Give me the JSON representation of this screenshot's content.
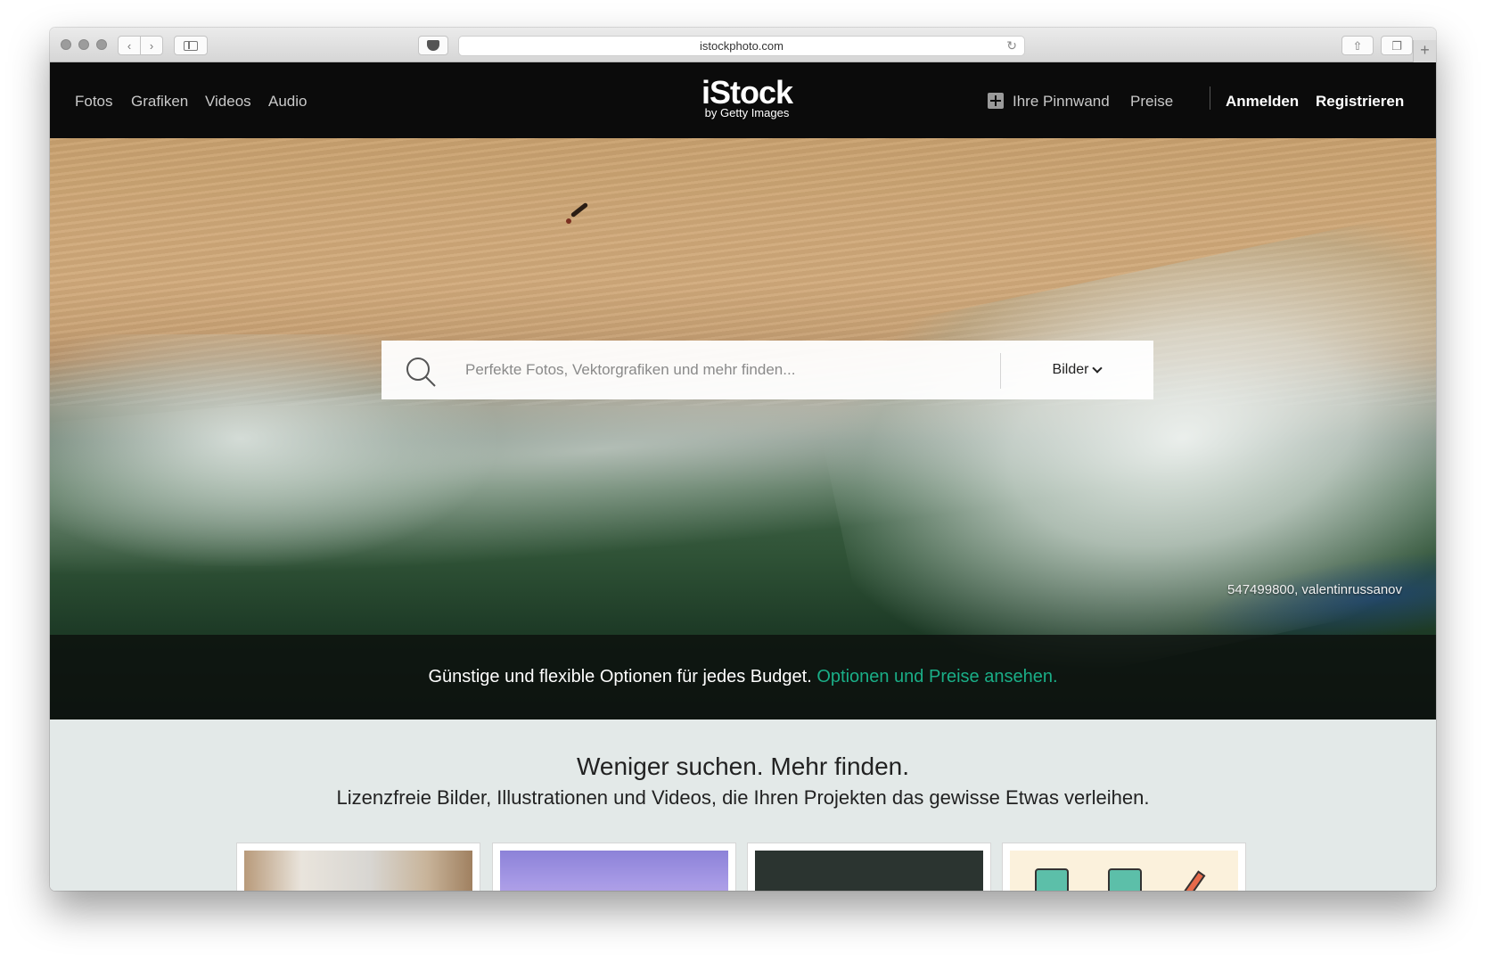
{
  "browser": {
    "url": "istockphoto.com"
  },
  "nav": {
    "left_links": [
      "Fotos",
      "Grafiken",
      "Videos",
      "Audio"
    ],
    "logo_main": "iStock",
    "logo_sub": "by Getty Images",
    "board_label": "Ihre Pinnwand",
    "pricing_label": "Preise",
    "signin_label": "Anmelden",
    "register_label": "Registrieren"
  },
  "search": {
    "placeholder": "Perfekte Fotos, Vektorgrafiken und mehr finden...",
    "type_selected": "Bilder"
  },
  "hero": {
    "credit": "547499800, valentinrussanov",
    "promo_text": "Günstige und flexible Optionen für jedes Budget.",
    "promo_link": "Optionen und Preise ansehen."
  },
  "content": {
    "headline": "Weniger suchen. Mehr finden.",
    "subline": "Lizenzfreie Bilder, Illustrationen und Videos, die Ihren Projekten das gewisse Etwas verleihen."
  },
  "colors": {
    "nav_bg": "#0b0b0b",
    "accent_green": "#1aae87",
    "content_bg": "#e3e9e8"
  }
}
